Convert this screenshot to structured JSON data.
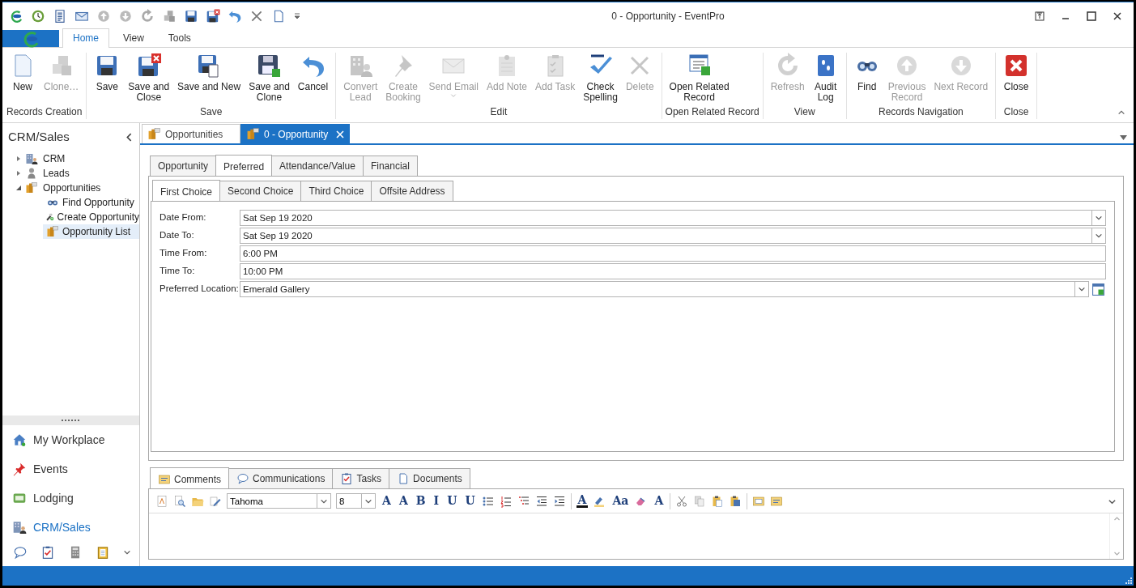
{
  "window": {
    "title": "0 - Opportunity - EventPro"
  },
  "ribbon_tabs": [
    {
      "label": "Home",
      "selected": true
    },
    {
      "label": "View",
      "selected": false
    },
    {
      "label": "Tools",
      "selected": false
    }
  ],
  "ribbon_groups": [
    {
      "label": "Records Creation",
      "buttons": [
        {
          "label": [
            "New"
          ],
          "disabled": false
        },
        {
          "label": [
            "Clone…"
          ],
          "disabled": true
        }
      ]
    },
    {
      "label": "Save",
      "buttons": [
        {
          "label": [
            "Save"
          ],
          "disabled": false
        },
        {
          "label": [
            "Save and",
            "Close"
          ],
          "disabled": false
        },
        {
          "label": [
            "Save and New"
          ],
          "disabled": false
        },
        {
          "label": [
            "Save and",
            "Clone"
          ],
          "disabled": false
        },
        {
          "label": [
            "Cancel"
          ],
          "disabled": false
        }
      ]
    },
    {
      "label": "Edit",
      "buttons": [
        {
          "label": [
            "Convert",
            "Lead"
          ],
          "disabled": true
        },
        {
          "label": [
            "Create",
            "Booking"
          ],
          "disabled": true
        },
        {
          "label": [
            "Send Email"
          ],
          "disabled": true,
          "has_menu": true
        },
        {
          "label": [
            "Add Note"
          ],
          "disabled": true
        },
        {
          "label": [
            "Add Task"
          ],
          "disabled": true
        },
        {
          "label": [
            "Check",
            "Spelling"
          ],
          "disabled": false
        },
        {
          "label": [
            "Delete"
          ],
          "disabled": true
        }
      ]
    },
    {
      "label": "Open Related Record",
      "buttons": [
        {
          "label": [
            "Open Related",
            "Record"
          ],
          "disabled": false
        }
      ]
    },
    {
      "label": "View",
      "buttons": [
        {
          "label": [
            "Refresh"
          ],
          "disabled": true
        },
        {
          "label": [
            "Audit",
            "Log"
          ],
          "disabled": false
        }
      ]
    },
    {
      "label": "Records Navigation",
      "buttons": [
        {
          "label": [
            "Find"
          ],
          "disabled": false
        },
        {
          "label": [
            "Previous",
            "Record"
          ],
          "disabled": true
        },
        {
          "label": [
            "Next Record"
          ],
          "disabled": true
        }
      ]
    },
    {
      "label": "Close",
      "buttons": [
        {
          "label": [
            "Close"
          ],
          "disabled": false
        }
      ]
    }
  ],
  "sidebar": {
    "title": "CRM/Sales",
    "tree": [
      {
        "label": "CRM",
        "expanded": false,
        "selected": false
      },
      {
        "label": "Leads",
        "expanded": false,
        "selected": false
      },
      {
        "label": "Opportunities",
        "expanded": true,
        "selected": false,
        "children": [
          {
            "label": "Find Opportunity",
            "selected": false
          },
          {
            "label": "Create Opportunity",
            "selected": false
          },
          {
            "label": "Opportunity List",
            "selected": true
          }
        ]
      }
    ],
    "nav": [
      {
        "label": "My Workplace",
        "selected": false
      },
      {
        "label": "Events",
        "selected": false
      },
      {
        "label": "Lodging",
        "selected": false
      },
      {
        "label": "CRM/Sales",
        "selected": true
      }
    ]
  },
  "doc_tabs": [
    {
      "label": "Opportunities",
      "selected": false,
      "closable": false
    },
    {
      "label": "0 - Opportunity",
      "selected": true,
      "closable": true
    }
  ],
  "form_tabs": [
    {
      "label": "Opportunity",
      "selected": false
    },
    {
      "label": "Preferred",
      "selected": true
    },
    {
      "label": "Attendance/Value",
      "selected": false
    },
    {
      "label": "Financial",
      "selected": false
    }
  ],
  "choice_tabs": [
    {
      "label": "First Choice",
      "selected": true
    },
    {
      "label": "Second Choice",
      "selected": false
    },
    {
      "label": "Third Choice",
      "selected": false
    },
    {
      "label": "Offsite Address",
      "selected": false
    }
  ],
  "fields": [
    {
      "label": "Date From:",
      "value": "Sat Sep 19 2020",
      "kind": "dropdown"
    },
    {
      "label": "Date To:",
      "value": "Sat Sep 19 2020",
      "kind": "dropdown"
    },
    {
      "label": "Time From:",
      "value": "6:00 PM",
      "kind": "text"
    },
    {
      "label": "Time To:",
      "value": "10:00 PM",
      "kind": "text"
    },
    {
      "label": "Preferred Location:",
      "value": "Emerald Gallery",
      "kind": "lookup"
    }
  ],
  "bottom_tabs": [
    {
      "label": "Comments",
      "selected": true
    },
    {
      "label": "Communications",
      "selected": false
    },
    {
      "label": "Tasks",
      "selected": false
    },
    {
      "label": "Documents",
      "selected": false
    }
  ],
  "editor": {
    "font": "Tahoma",
    "size": "8",
    "glyphs": [
      "A",
      "A",
      "B",
      "I",
      "U",
      "U",
      "A",
      "Aa",
      "A"
    ]
  }
}
